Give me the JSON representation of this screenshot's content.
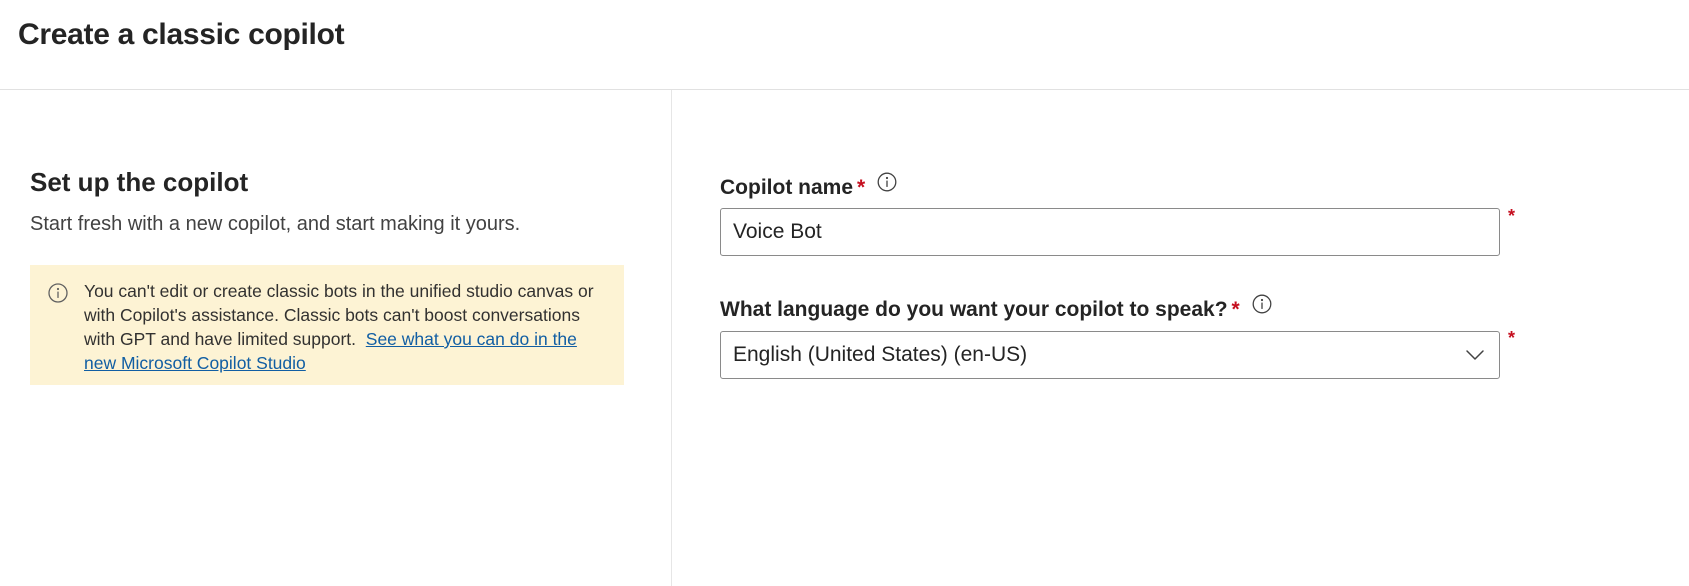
{
  "header": {
    "title": "Create a classic copilot"
  },
  "setup": {
    "title": "Set up the copilot",
    "description": "Start fresh with a new copilot, and start making it yours.",
    "notice": {
      "icon": "info-icon",
      "text": "You can't edit or create classic bots in the unified studio canvas or with Copilot's assistance. Classic bots can't boost conversations with GPT and have limited support.",
      "link_text": "See what you can do in the new Microsoft Copilot Studio",
      "background_color": "#fdf3d4"
    }
  },
  "form": {
    "copilot_name": {
      "label": "Copilot name",
      "required_marker": "*",
      "value": "Voice Bot",
      "info_icon": "info-icon"
    },
    "language": {
      "label": "What language do you want your copilot to speak?",
      "required_marker": "*",
      "selected": "English (United States) (en-US)",
      "info_icon": "info-icon",
      "dropdown_icon": "chevron-down-icon"
    }
  },
  "colors": {
    "required": "#c50f1f",
    "link": "#115ea3"
  }
}
